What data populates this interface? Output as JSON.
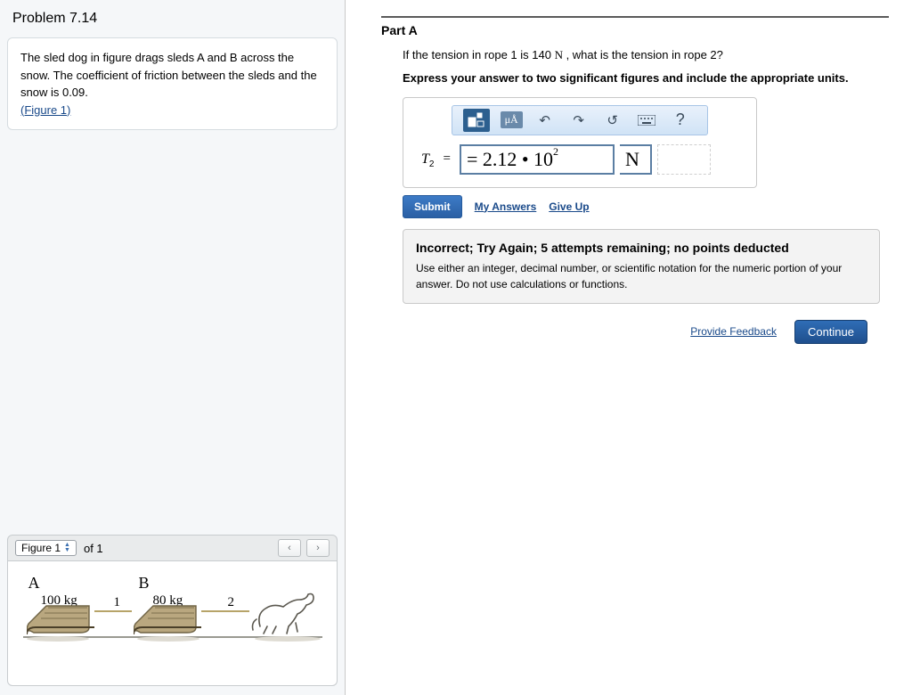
{
  "left": {
    "problem_title": "Problem 7.14",
    "problem_text": "The sled dog in figure drags sleds A and B across the snow. The coefficient of friction between the sleds and the snow is 0.09.",
    "figure_link": "(Figure 1)",
    "figure_label": "Figure 1",
    "figure_of": "of 1",
    "sled_a_label": "A",
    "sled_a_mass": "100 kg",
    "rope1_label": "1",
    "sled_b_label": "B",
    "sled_b_mass": "80 kg",
    "rope2_label": "2"
  },
  "right": {
    "part_title": "Part A",
    "question_pre": "If the tension in rope 1 is 140 ",
    "question_unit": "N",
    "question_post": " , what is the tension in rope 2?",
    "instruction": "Express your answer to two significant figures and include the appropriate units.",
    "toolbar_mu": "μÅ",
    "toolbar_help": "?",
    "var_symbol": "T",
    "var_sub": "2",
    "equals": "=",
    "answer_value": "= 2.12 • 10",
    "answer_exp": "2",
    "answer_unit": "N",
    "submit": "Submit",
    "my_answers": "My Answers",
    "give_up": "Give Up",
    "fb_title": "Incorrect; Try Again; 5 attempts remaining; no points deducted",
    "fb_body": "Use either an integer, decimal number, or scientific notation for the numeric portion of your answer. Do not use calculations or functions.",
    "provide_feedback": "Provide Feedback",
    "continue": "Continue"
  }
}
